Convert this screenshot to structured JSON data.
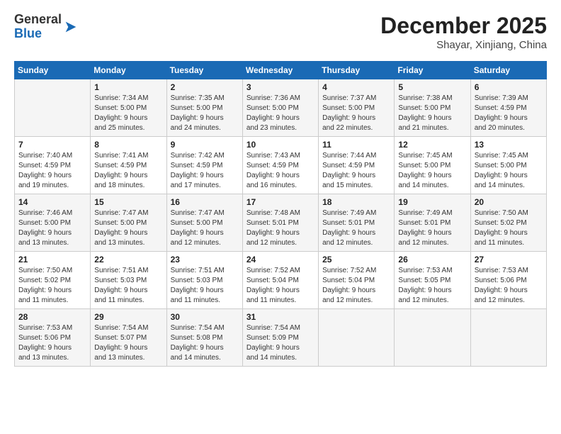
{
  "header": {
    "logo": {
      "general": "General",
      "blue": "Blue"
    },
    "month": "December 2025",
    "location": "Shayar, Xinjiang, China"
  },
  "days_of_week": [
    "Sunday",
    "Monday",
    "Tuesday",
    "Wednesday",
    "Thursday",
    "Friday",
    "Saturday"
  ],
  "weeks": [
    [
      {
        "day": "",
        "info": ""
      },
      {
        "day": "1",
        "info": "Sunrise: 7:34 AM\nSunset: 5:00 PM\nDaylight: 9 hours\nand 25 minutes."
      },
      {
        "day": "2",
        "info": "Sunrise: 7:35 AM\nSunset: 5:00 PM\nDaylight: 9 hours\nand 24 minutes."
      },
      {
        "day": "3",
        "info": "Sunrise: 7:36 AM\nSunset: 5:00 PM\nDaylight: 9 hours\nand 23 minutes."
      },
      {
        "day": "4",
        "info": "Sunrise: 7:37 AM\nSunset: 5:00 PM\nDaylight: 9 hours\nand 22 minutes."
      },
      {
        "day": "5",
        "info": "Sunrise: 7:38 AM\nSunset: 5:00 PM\nDaylight: 9 hours\nand 21 minutes."
      },
      {
        "day": "6",
        "info": "Sunrise: 7:39 AM\nSunset: 4:59 PM\nDaylight: 9 hours\nand 20 minutes."
      }
    ],
    [
      {
        "day": "7",
        "info": "Sunrise: 7:40 AM\nSunset: 4:59 PM\nDaylight: 9 hours\nand 19 minutes."
      },
      {
        "day": "8",
        "info": "Sunrise: 7:41 AM\nSunset: 4:59 PM\nDaylight: 9 hours\nand 18 minutes."
      },
      {
        "day": "9",
        "info": "Sunrise: 7:42 AM\nSunset: 4:59 PM\nDaylight: 9 hours\nand 17 minutes."
      },
      {
        "day": "10",
        "info": "Sunrise: 7:43 AM\nSunset: 4:59 PM\nDaylight: 9 hours\nand 16 minutes."
      },
      {
        "day": "11",
        "info": "Sunrise: 7:44 AM\nSunset: 4:59 PM\nDaylight: 9 hours\nand 15 minutes."
      },
      {
        "day": "12",
        "info": "Sunrise: 7:45 AM\nSunset: 5:00 PM\nDaylight: 9 hours\nand 14 minutes."
      },
      {
        "day": "13",
        "info": "Sunrise: 7:45 AM\nSunset: 5:00 PM\nDaylight: 9 hours\nand 14 minutes."
      }
    ],
    [
      {
        "day": "14",
        "info": "Sunrise: 7:46 AM\nSunset: 5:00 PM\nDaylight: 9 hours\nand 13 minutes."
      },
      {
        "day": "15",
        "info": "Sunrise: 7:47 AM\nSunset: 5:00 PM\nDaylight: 9 hours\nand 13 minutes."
      },
      {
        "day": "16",
        "info": "Sunrise: 7:47 AM\nSunset: 5:00 PM\nDaylight: 9 hours\nand 12 minutes."
      },
      {
        "day": "17",
        "info": "Sunrise: 7:48 AM\nSunset: 5:01 PM\nDaylight: 9 hours\nand 12 minutes."
      },
      {
        "day": "18",
        "info": "Sunrise: 7:49 AM\nSunset: 5:01 PM\nDaylight: 9 hours\nand 12 minutes."
      },
      {
        "day": "19",
        "info": "Sunrise: 7:49 AM\nSunset: 5:01 PM\nDaylight: 9 hours\nand 12 minutes."
      },
      {
        "day": "20",
        "info": "Sunrise: 7:50 AM\nSunset: 5:02 PM\nDaylight: 9 hours\nand 11 minutes."
      }
    ],
    [
      {
        "day": "21",
        "info": "Sunrise: 7:50 AM\nSunset: 5:02 PM\nDaylight: 9 hours\nand 11 minutes."
      },
      {
        "day": "22",
        "info": "Sunrise: 7:51 AM\nSunset: 5:03 PM\nDaylight: 9 hours\nand 11 minutes."
      },
      {
        "day": "23",
        "info": "Sunrise: 7:51 AM\nSunset: 5:03 PM\nDaylight: 9 hours\nand 11 minutes."
      },
      {
        "day": "24",
        "info": "Sunrise: 7:52 AM\nSunset: 5:04 PM\nDaylight: 9 hours\nand 11 minutes."
      },
      {
        "day": "25",
        "info": "Sunrise: 7:52 AM\nSunset: 5:04 PM\nDaylight: 9 hours\nand 12 minutes."
      },
      {
        "day": "26",
        "info": "Sunrise: 7:53 AM\nSunset: 5:05 PM\nDaylight: 9 hours\nand 12 minutes."
      },
      {
        "day": "27",
        "info": "Sunrise: 7:53 AM\nSunset: 5:06 PM\nDaylight: 9 hours\nand 12 minutes."
      }
    ],
    [
      {
        "day": "28",
        "info": "Sunrise: 7:53 AM\nSunset: 5:06 PM\nDaylight: 9 hours\nand 13 minutes."
      },
      {
        "day": "29",
        "info": "Sunrise: 7:54 AM\nSunset: 5:07 PM\nDaylight: 9 hours\nand 13 minutes."
      },
      {
        "day": "30",
        "info": "Sunrise: 7:54 AM\nSunset: 5:08 PM\nDaylight: 9 hours\nand 14 minutes."
      },
      {
        "day": "31",
        "info": "Sunrise: 7:54 AM\nSunset: 5:09 PM\nDaylight: 9 hours\nand 14 minutes."
      },
      {
        "day": "",
        "info": ""
      },
      {
        "day": "",
        "info": ""
      },
      {
        "day": "",
        "info": ""
      }
    ]
  ]
}
